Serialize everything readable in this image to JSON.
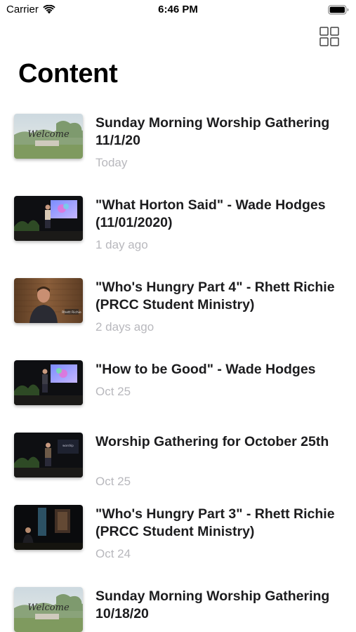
{
  "status_bar": {
    "carrier": "Carrier",
    "time": "6:46 PM",
    "wifi_icon": "wifi-icon",
    "battery_icon": "battery-icon"
  },
  "toolbar": {
    "grid_toggle_icon": "grid-icon"
  },
  "page": {
    "title": "Content"
  },
  "items": [
    {
      "title": "Sunday Morning Worship Gathering 11/1/20",
      "date": "Today",
      "thumbnail": "welcome-slide"
    },
    {
      "title": "\"What Horton Said\" - Wade Hodges (11/01/2020)",
      "date": "1 day ago",
      "thumbnail": "stage-speaker"
    },
    {
      "title": "\"Who's Hungry Part 4\" - Rhett Richie (PRCC Student Ministry)",
      "date": "2 days ago",
      "thumbnail": "speaker-closeup"
    },
    {
      "title": "\"How to be Good\" - Wade Hodges",
      "date": "Oct 25",
      "thumbnail": "stage-speaker"
    },
    {
      "title": "Worship Gathering for October 25th",
      "date": "Oct 25",
      "thumbnail": "stage-speaker"
    },
    {
      "title": "\"Who's Hungry Part 3\" - Rhett Richie (PRCC Student Ministry)",
      "date": "Oct 24",
      "thumbnail": "dark-stage"
    },
    {
      "title": "Sunday Morning Worship Gathering 10/18/20",
      "date": "",
      "thumbnail": "welcome-slide"
    }
  ],
  "colors": {
    "date_text": "#b8b8bd",
    "title_text": "#1c1c1e",
    "background": "#ffffff"
  }
}
